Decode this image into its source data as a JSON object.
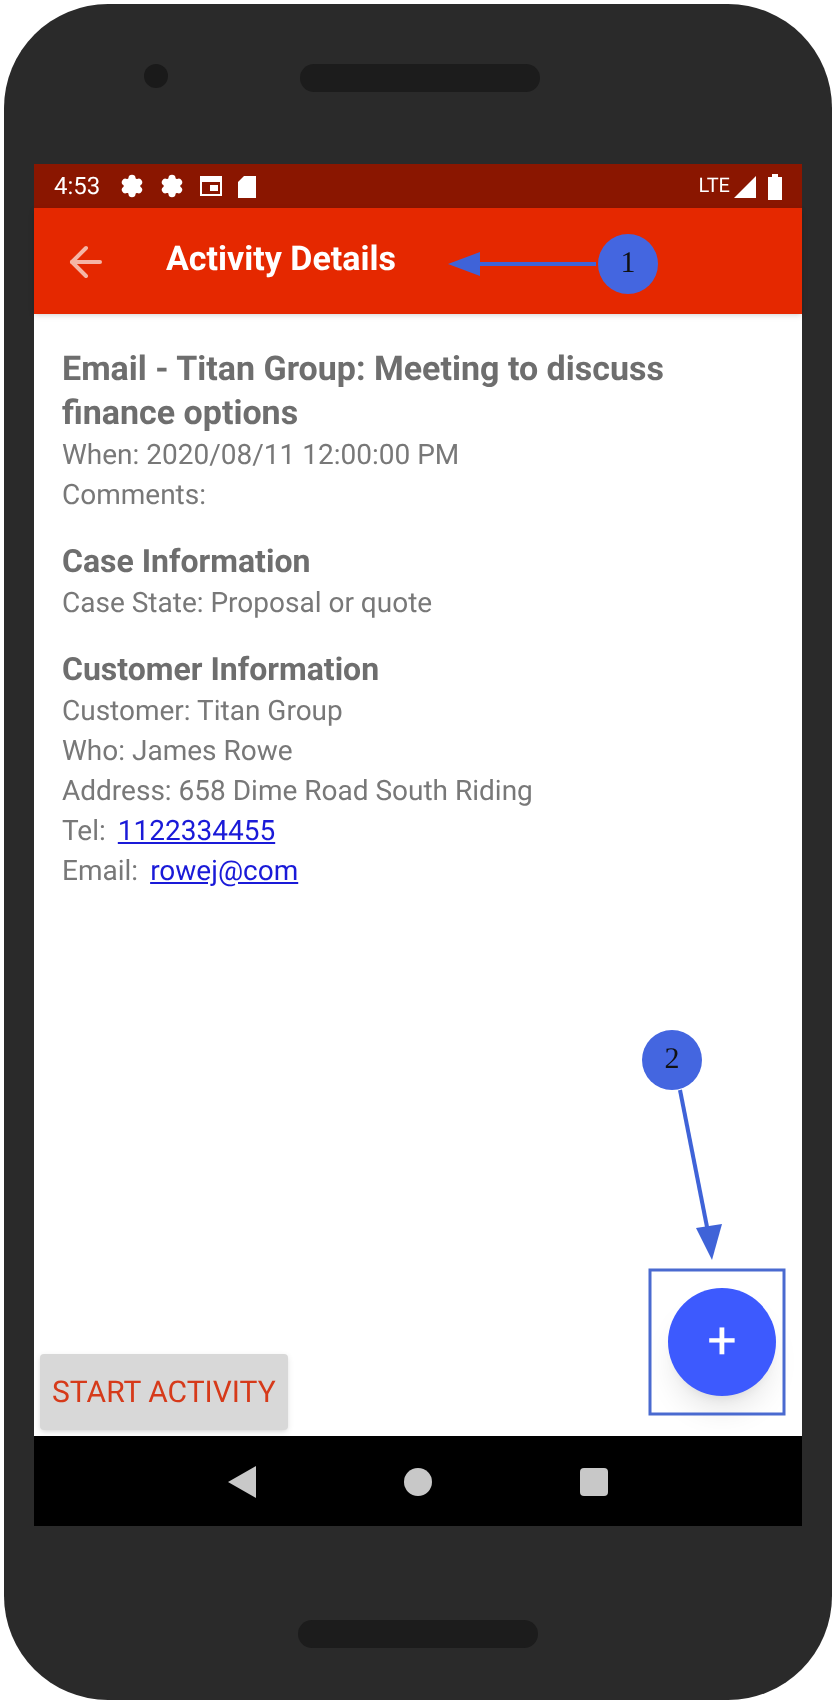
{
  "status_bar": {
    "time": "4:53",
    "network": "LTE"
  },
  "app_bar": {
    "title": "Activity Details"
  },
  "activity": {
    "title": "Email - Titan Group: Meeting to discuss finance options",
    "lines": [
      {
        "label": "When: 2020/08/11 12:00:00 PM"
      },
      {
        "label": "Comments:"
      }
    ]
  },
  "sections": [
    {
      "heading": "Case Information",
      "lines": [
        {
          "label": "Case State: Proposal or quote"
        }
      ]
    },
    {
      "heading": "Customer Information",
      "lines": [
        {
          "label": "Customer: Titan Group"
        },
        {
          "label": "Who: James Rowe"
        },
        {
          "label": "Address: 658 Dime Road South Riding"
        },
        {
          "label": "Tel:",
          "link": "1122334455"
        },
        {
          "label": "Email:",
          "link": "rowej@com"
        }
      ]
    }
  ],
  "start_button": {
    "label": "START ACTIVITY"
  },
  "fab": {
    "label": "+"
  },
  "callouts": [
    {
      "number": "1"
    },
    {
      "number": "2"
    }
  ]
}
